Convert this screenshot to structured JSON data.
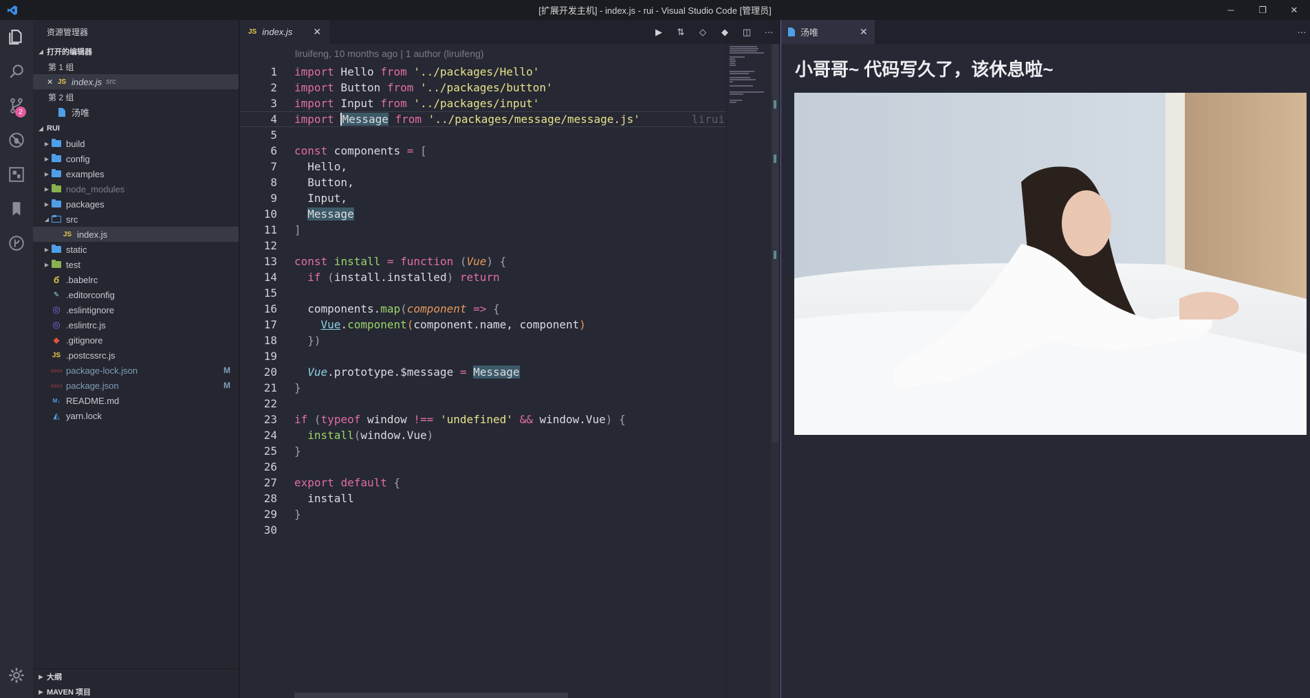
{
  "window": {
    "title": "[扩展开发主机] - index.js - rui - Visual Studio Code [管理员]",
    "controls": [
      "─",
      "❐",
      "✕"
    ]
  },
  "activity": {
    "scm_badge": "2"
  },
  "sidebar": {
    "title": "资源管理器",
    "open_editors_header": "打开的编辑器",
    "group1": "第 1 组",
    "group1_file": {
      "name": "index.js",
      "desc": "src",
      "close": "✕"
    },
    "group2": "第 2 组",
    "group2_file": {
      "name": "汤唯"
    },
    "project_header": "RUI",
    "tree": [
      {
        "name": "build",
        "modified": ""
      },
      {
        "name": "config",
        "modified": ""
      },
      {
        "name": "examples",
        "modified": ""
      },
      {
        "name": "node_modules",
        "modified": ""
      },
      {
        "name": "packages",
        "modified": ""
      },
      {
        "name": "src",
        "modified": ""
      },
      {
        "name": "index.js",
        "modified": ""
      },
      {
        "name": "static",
        "modified": ""
      },
      {
        "name": "test",
        "modified": ""
      },
      {
        "name": ".babelrc",
        "modified": ""
      },
      {
        "name": ".editorconfig",
        "modified": ""
      },
      {
        "name": ".eslintignore",
        "modified": ""
      },
      {
        "name": ".eslintrc.js",
        "modified": ""
      },
      {
        "name": ".gitignore",
        "modified": ""
      },
      {
        "name": ".postcssrc.js",
        "modified": ""
      },
      {
        "name": "package-lock.json",
        "modified": "M"
      },
      {
        "name": "package.json",
        "modified": "M"
      },
      {
        "name": "README.md",
        "modified": ""
      },
      {
        "name": "yarn.lock",
        "modified": ""
      }
    ],
    "outline": "大纲",
    "maven": "MAVEN 项目"
  },
  "editor": {
    "tab": {
      "icon": "JS",
      "name": "index.js",
      "close": "✕"
    },
    "blame": "liruifeng, 10 months ago | 1 author (liruifeng)",
    "trailing_blame": "lirui",
    "line_numbers": [
      "1",
      "2",
      "3",
      "4",
      "5",
      "6",
      "7",
      "8",
      "9",
      "10",
      "11",
      "12",
      "13",
      "14",
      "15",
      "16",
      "17",
      "18",
      "19",
      "20",
      "21",
      "22",
      "23",
      "24",
      "25",
      "26",
      "27",
      "28",
      "29",
      "30"
    ],
    "code": {
      "l1": [
        "import",
        " Hello ",
        "from",
        " '../packages/Hello'"
      ],
      "l2": [
        "import",
        " Button ",
        "from",
        " '../packages/button'"
      ],
      "l3": [
        "import",
        " Input ",
        "from",
        " '../packages/input'"
      ],
      "l4": [
        "import",
        " ",
        "Message",
        " ",
        "from",
        " '../packages/message/message.js'"
      ],
      "l6": [
        "const",
        " components ",
        "=",
        " ["
      ],
      "l7": "  Hello,",
      "l8": "  Button,",
      "l9": "  Input,",
      "l10": [
        "  ",
        "Message"
      ],
      "l11": "]",
      "l13": [
        "const",
        " install ",
        "=",
        " ",
        "function",
        " ",
        "(",
        "Vue",
        ")",
        " {"
      ],
      "l14": [
        "  ",
        "if",
        " ",
        "(",
        "install.installed",
        ")",
        " ",
        "return"
      ],
      "l16": [
        "  components.",
        "map",
        "(",
        "component",
        " ",
        "=>",
        " {"
      ],
      "l17": [
        "    ",
        "Vue",
        ".",
        "component",
        "(",
        "component.name, component",
        ")"
      ],
      "l18": [
        "  ",
        "})"
      ],
      "l20": [
        "  ",
        "Vue",
        ".prototype.$message ",
        "=",
        " ",
        "Message"
      ],
      "l21": "}",
      "l23": [
        "if",
        " ",
        "(",
        "typeof",
        " window ",
        "!==",
        " ",
        "'undefined'",
        " ",
        "&&",
        " window.Vue",
        ")",
        " {"
      ],
      "l24": [
        "  ",
        "install",
        "(",
        "window.Vue",
        ")"
      ],
      "l25": "}",
      "l27": [
        "export",
        " ",
        "default",
        " {"
      ],
      "l28": "  install",
      "l29": "}"
    }
  },
  "webview": {
    "tab": {
      "name": "汤唯",
      "close": "✕"
    },
    "heading": "小哥哥~ 代码写久了，该休息啦~"
  },
  "colors": {
    "keyword": "#e26fa4",
    "string": "#e9e28b",
    "function": "#9ad66a",
    "param": "#e79a5c",
    "type": "#8ed3e6",
    "badge": "#e0599b",
    "folder": "#4f9fe8"
  }
}
